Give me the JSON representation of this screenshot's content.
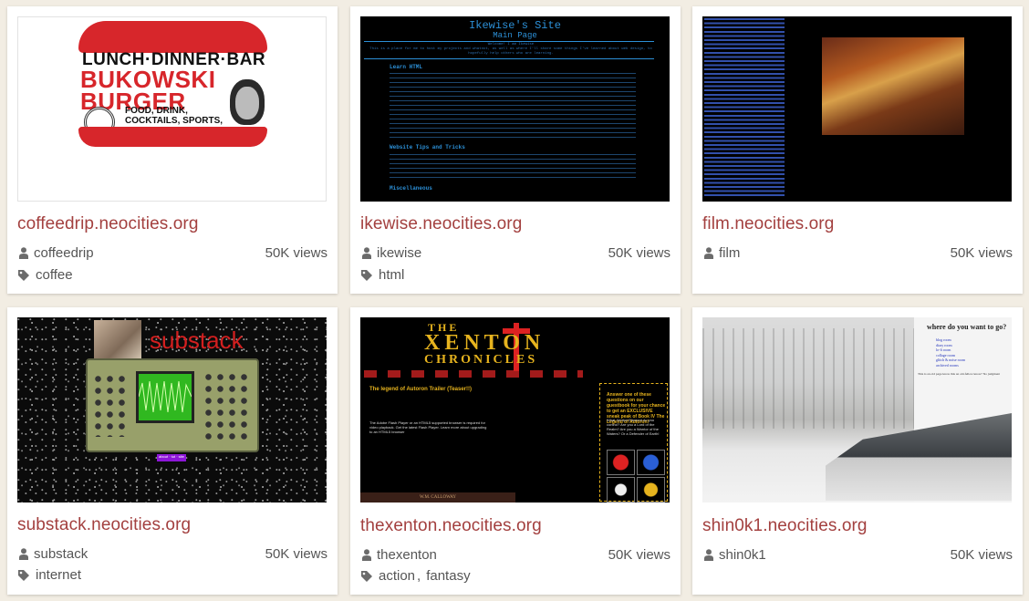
{
  "cards": [
    {
      "site": "coffeedrip.neocities.org",
      "user": "coffeedrip",
      "views": "50K views",
      "tags": [
        "coffee"
      ],
      "thumb": {
        "line1": "LUNCH·DINNER·BAR",
        "line2a": "BUKOWSKI",
        "line2b": "BURGER",
        "line3": "FOOD, DRINK, COCKTAILS, SPORTS, MUSIC, FREEDOM!"
      }
    },
    {
      "site": "ikewise.neocities.org",
      "user": "ikewise",
      "views": "50K views",
      "tags": [
        "html"
      ],
      "thumb": {
        "title": "Ikewise's Site",
        "subtitle": "Main Page",
        "welcome": "Welcome! I am Ikewise",
        "intro": "This is a place for me to host my projects and whatnot, as well as where I'll share some things I've learned about web design, to hopefully help others who are learning.",
        "h_learn": "Learn HTML",
        "h_tips": "Website Tips and Tricks",
        "h_misc": "Miscellaneous"
      }
    },
    {
      "site": "film.neocities.org",
      "user": "film",
      "views": "50K views",
      "tags": []
    },
    {
      "site": "substack.neocities.org",
      "user": "substack",
      "views": "50K views",
      "tags": [
        "internet"
      ],
      "thumb": {
        "word": "substack",
        "label": "about · tut · site"
      }
    },
    {
      "site": "thexenton.neocities.org",
      "user": "thexenton",
      "views": "50K views",
      "tags": [
        "action",
        "fantasy"
      ],
      "thumb": {
        "t1": "THE",
        "t2": "XENTON",
        "t3": "CHRONICLES",
        "sub": "The legend of Autoron Trailer (Teaser!!)",
        "flash": "The Adobe Flash Player or an HTML5 supported browser is required for video playback. Get the latest Flash Player. Learn more about upgrading to an HTML5 browser",
        "box": "Answer one of these questions on our guestbook for your chance to get an EXCLUSIVE sneak peak of Book IV The Legend of Autoron!",
        "box_small": "What Xenton Element do you control? Are you a Lord of the Realm? Are you a Warrior of the Waters? Or a Defender of Earth!",
        "footer": "W.M. CALLOWAY"
      }
    },
    {
      "site": "shin0k1.neocities.org",
      "user": "shin0k1",
      "views": "50K views",
      "tags": [],
      "thumb": {
        "heading": "where do you want to go?",
        "links": [
          "blog room",
          "diary room",
          "lo-fi room",
          "collage room",
          "glitch & noise room",
          "archived rooms"
        ],
        "note": "This is an old page know this an old-fellow know? No judgment"
      }
    }
  ],
  "colors": {
    "background": "#f2ede3",
    "link": "#a3403f",
    "meta_text": "#555555",
    "card": "#ffffff"
  },
  "icons": {
    "user": "user-icon",
    "tag": "tag-icon"
  }
}
